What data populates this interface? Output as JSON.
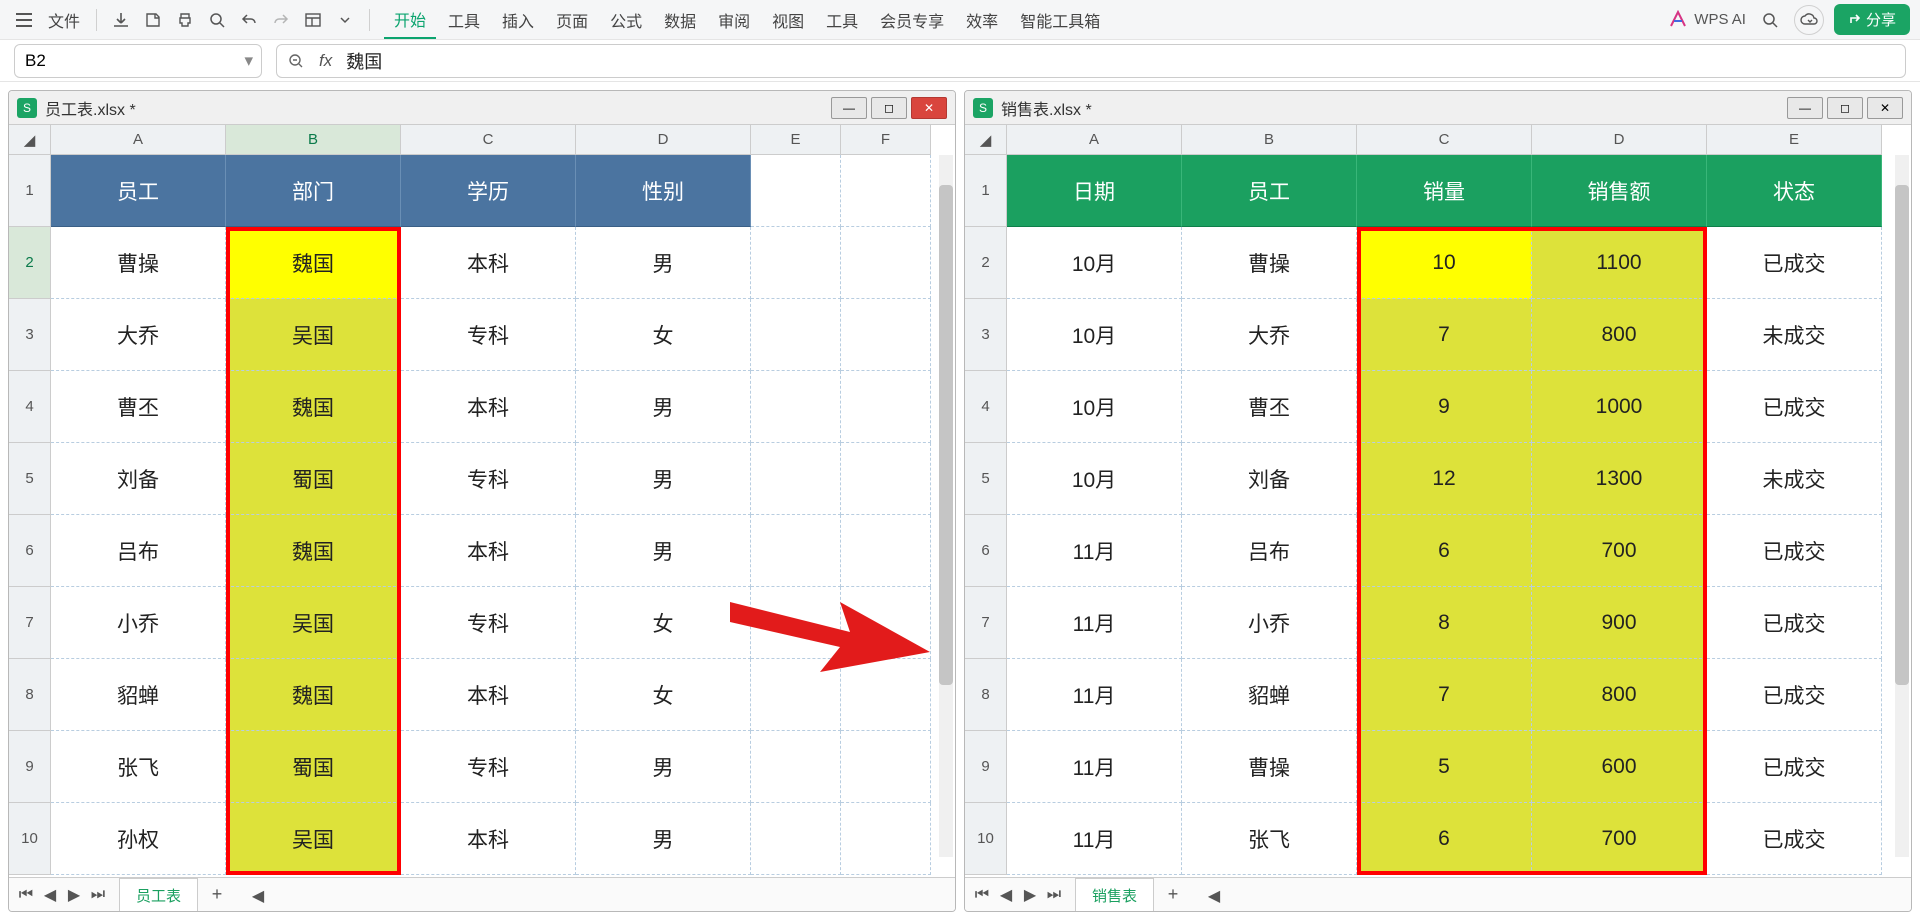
{
  "ribbon": {
    "file_label": "文件",
    "tabs": [
      "开始",
      "工具",
      "插入",
      "页面",
      "公式",
      "数据",
      "审阅",
      "视图",
      "工具",
      "会员专享",
      "效率",
      "智能工具箱"
    ],
    "active_tab": 0,
    "ai_brand": "WPS AI",
    "share_label": "分享"
  },
  "formula": {
    "namebox": "B2",
    "content": "魏国"
  },
  "left_window": {
    "title": "员工表.xlsx *",
    "sheet_tab": "员工表",
    "col_headers": [
      "A",
      "B",
      "C",
      "D",
      "E",
      "F"
    ],
    "row_headers": [
      "1",
      "2",
      "3",
      "4",
      "5",
      "6",
      "7",
      "8",
      "9",
      "10"
    ],
    "header_row": [
      "员工",
      "部门",
      "学历",
      "性别"
    ],
    "rows": [
      [
        "曹操",
        "魏国",
        "本科",
        "男"
      ],
      [
        "大乔",
        "吴国",
        "专科",
        "女"
      ],
      [
        "曹丕",
        "魏国",
        "本科",
        "男"
      ],
      [
        "刘备",
        "蜀国",
        "专科",
        "男"
      ],
      [
        "吕布",
        "魏国",
        "本科",
        "男"
      ],
      [
        "小乔",
        "吴国",
        "专科",
        "女"
      ],
      [
        "貂蝉",
        "魏国",
        "本科",
        "女"
      ],
      [
        "张飞",
        "蜀国",
        "专科",
        "男"
      ],
      [
        "孙权",
        "吴国",
        "本科",
        "男"
      ]
    ]
  },
  "right_window": {
    "title": "销售表.xlsx *",
    "sheet_tab": "销售表",
    "col_headers": [
      "A",
      "B",
      "C",
      "D",
      "E"
    ],
    "row_headers": [
      "1",
      "2",
      "3",
      "4",
      "5",
      "6",
      "7",
      "8",
      "9",
      "10"
    ],
    "header_row": [
      "日期",
      "员工",
      "销量",
      "销售额",
      "状态"
    ],
    "rows": [
      [
        "10月",
        "曹操",
        "10",
        "1100",
        "已成交"
      ],
      [
        "10月",
        "大乔",
        "7",
        "800",
        "未成交"
      ],
      [
        "10月",
        "曹丕",
        "9",
        "1000",
        "已成交"
      ],
      [
        "10月",
        "刘备",
        "12",
        "1300",
        "未成交"
      ],
      [
        "11月",
        "吕布",
        "6",
        "700",
        "已成交"
      ],
      [
        "11月",
        "小乔",
        "8",
        "900",
        "已成交"
      ],
      [
        "11月",
        "貂蝉",
        "7",
        "800",
        "已成交"
      ],
      [
        "11月",
        "曹操",
        "5",
        "600",
        "已成交"
      ],
      [
        "11月",
        "张飞",
        "6",
        "700",
        "已成交"
      ]
    ]
  }
}
